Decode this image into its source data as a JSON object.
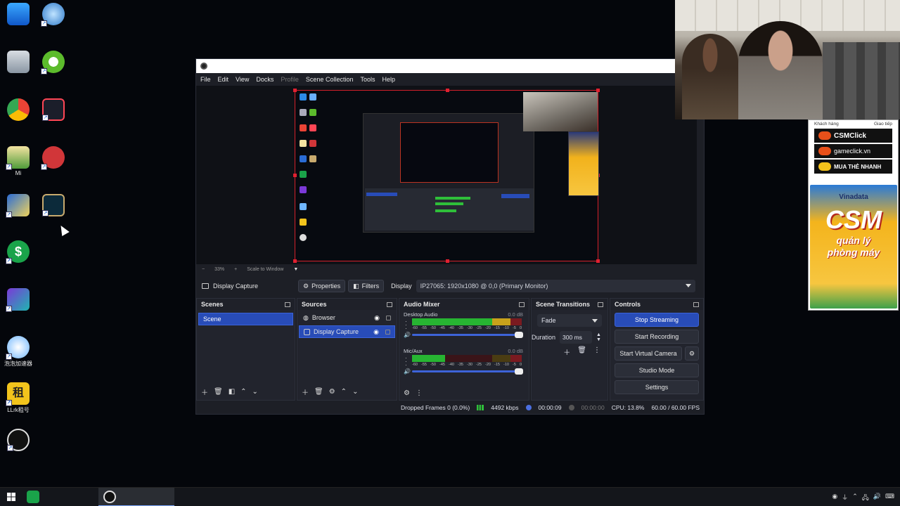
{
  "desktop": {
    "icons": [
      {
        "id": "computer",
        "label": ""
      },
      {
        "id": "network",
        "label": ""
      },
      {
        "id": "recycle-bin",
        "label": ""
      },
      {
        "id": "green-app",
        "label": ""
      },
      {
        "id": "chrome",
        "label": ""
      },
      {
        "id": "valorant",
        "label": ""
      },
      {
        "id": "document",
        "label": "Mi"
      },
      {
        "id": "riot",
        "label": ""
      },
      {
        "id": "blue-app",
        "label": ""
      },
      {
        "id": "league",
        "label": ""
      },
      {
        "id": "dollar-app",
        "label": ""
      },
      {
        "id": "kz-app",
        "label": ""
      },
      {
        "id": "cloud-app",
        "label": "泡泡加速器"
      },
      {
        "id": "rent-app",
        "label": "LLrk租号"
      },
      {
        "id": "obs",
        "label": ""
      }
    ]
  },
  "obs": {
    "menu": [
      "File",
      "Edit",
      "View",
      "Docks",
      "Profile",
      "Scene Collection",
      "Tools",
      "Help"
    ],
    "zoom": {
      "percent": "33%",
      "mode": "Scale to Window"
    },
    "source_toolbar": {
      "source_name": "Display Capture",
      "properties": "Properties",
      "filters": "Filters",
      "display_label": "Display",
      "display_value": "IP27065: 1920x1080 @ 0,0 (Primary Monitor)"
    },
    "scenes": {
      "title": "Scenes",
      "items": [
        "Scene"
      ]
    },
    "sources": {
      "title": "Sources",
      "items": [
        "Browser",
        "Display Capture"
      ]
    },
    "mixer": {
      "title": "Audio Mixer",
      "tracks": [
        {
          "name": "Desktop Audio",
          "db": "0.0 dB",
          "level": 0.82
        },
        {
          "name": "Mic/Aux",
          "db": "0.0 dB",
          "level": 0.3
        }
      ],
      "ticks": [
        "-60",
        "-55",
        "-50",
        "-45",
        "-40",
        "-35",
        "-30",
        "-25",
        "-20",
        "-15",
        "-10",
        "-5",
        "0"
      ]
    },
    "transitions": {
      "title": "Scene Transitions",
      "selected": "Fade",
      "duration_label": "Duration",
      "duration_value": "300 ms"
    },
    "controls": {
      "title": "Controls",
      "stop_streaming": "Stop Streaming",
      "start_recording": "Start Recording",
      "start_virtual_camera": "Start Virtual Camera",
      "studio_mode": "Studio Mode",
      "settings": "Settings"
    },
    "status": {
      "dropped_frames": "Dropped Frames 0 (0.0%)",
      "bitrate": "4492 kbps",
      "stream_time": "00:00:09",
      "record_time": "00:00:00",
      "cpu": "CPU: 13.8%",
      "fps": "60.00 / 60.00 FPS"
    }
  },
  "ad": {
    "tabs": [
      "Khách hàng",
      "Giao tiếp"
    ],
    "rows": [
      "CSMClick",
      "gameclick.vn",
      "MUA THẺ NHANH"
    ],
    "brand": "Vinadata",
    "big": "CSM",
    "sub1": "quản lý",
    "sub2": "phòng máy"
  }
}
